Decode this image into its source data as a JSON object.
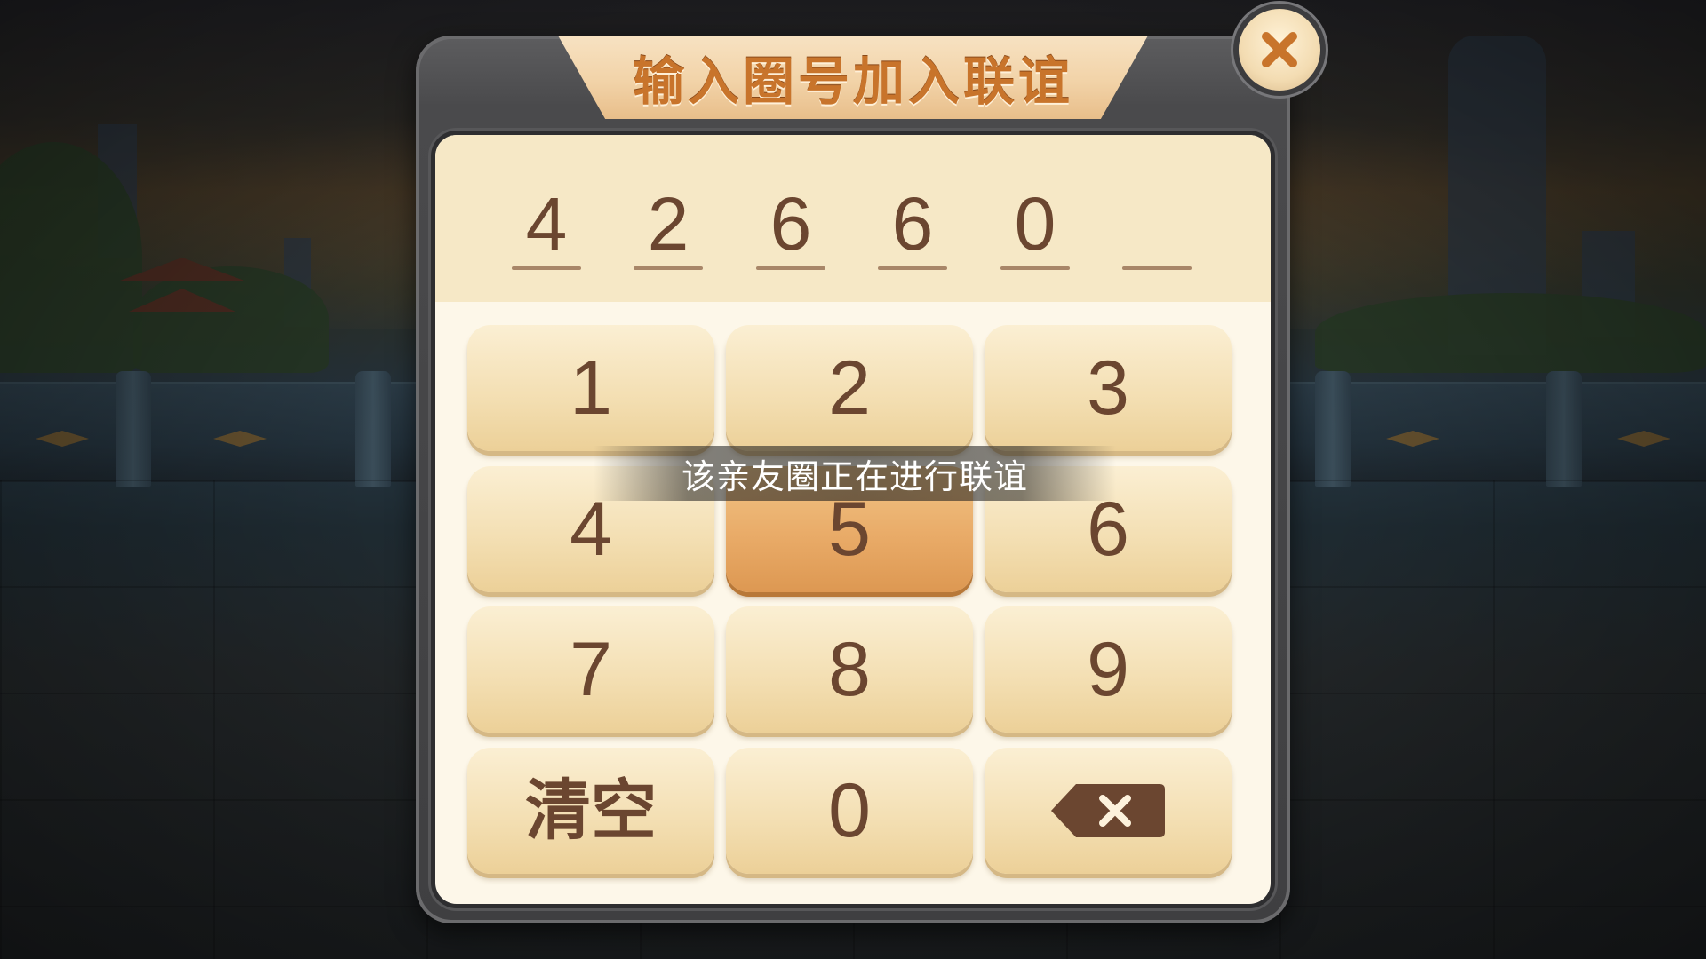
{
  "dialog": {
    "title": "输入圈号加入联谊",
    "close_icon": "close-icon"
  },
  "code_display": {
    "digits": [
      "4",
      "2",
      "6",
      "6",
      "0",
      ""
    ]
  },
  "keypad": {
    "keys": [
      {
        "label": "1"
      },
      {
        "label": "2"
      },
      {
        "label": "3"
      },
      {
        "label": "4"
      },
      {
        "label": "5",
        "pressed": true
      },
      {
        "label": "6"
      },
      {
        "label": "7"
      },
      {
        "label": "8"
      },
      {
        "label": "9"
      },
      {
        "label": "清空"
      },
      {
        "label": "0"
      },
      {
        "icon": "backspace-icon"
      }
    ]
  },
  "toast": {
    "message": "该亲友圈正在进行联谊"
  },
  "colors": {
    "panel": "#fdf7e9",
    "display": "#f6e8c6",
    "key": "#f3deb1",
    "key_pressed": "#e9ab68",
    "text_brown": "#6b4630",
    "title_orange": "#c8742b"
  }
}
